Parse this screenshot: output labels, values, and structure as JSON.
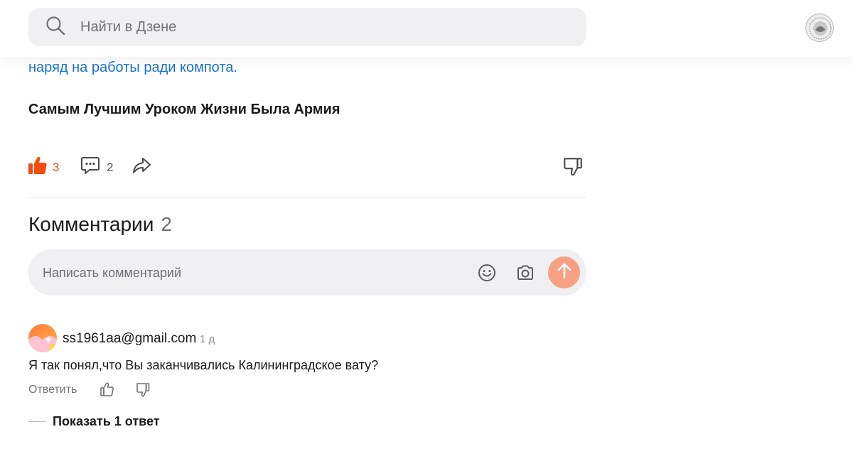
{
  "header": {
    "search_placeholder": "Найти в Дзене"
  },
  "article": {
    "link_text": "наряд на работы ради компота.",
    "closing_line": "Самым Лучшим Уроком Жизни Была Армия",
    "likes": "3",
    "comments_count": "2"
  },
  "comments": {
    "title": "Комментарии",
    "count": "2",
    "input_placeholder": "Написать комментарий",
    "items": [
      {
        "author": "ss1961aa@gmail.com",
        "time": "1 д",
        "text": "Я так понял,что Вы заканчивались Калининградское вату?",
        "reply_label": "Ответить",
        "show_replies_label": "Показать 1 ответ"
      }
    ]
  },
  "colors": {
    "accent_orange": "#f24c13",
    "send_button": "#f6a182",
    "link_blue": "#1a73c9",
    "field_bg": "#f0f0f2"
  },
  "icons": {
    "search": "search-icon",
    "like_active": "thumb-up-filled-icon",
    "comment": "comment-bubble-icon",
    "share": "share-arrow-icon",
    "dislike": "thumb-down-icon",
    "emoji": "emoji-icon",
    "camera": "camera-icon",
    "send": "arrow-up-icon"
  }
}
